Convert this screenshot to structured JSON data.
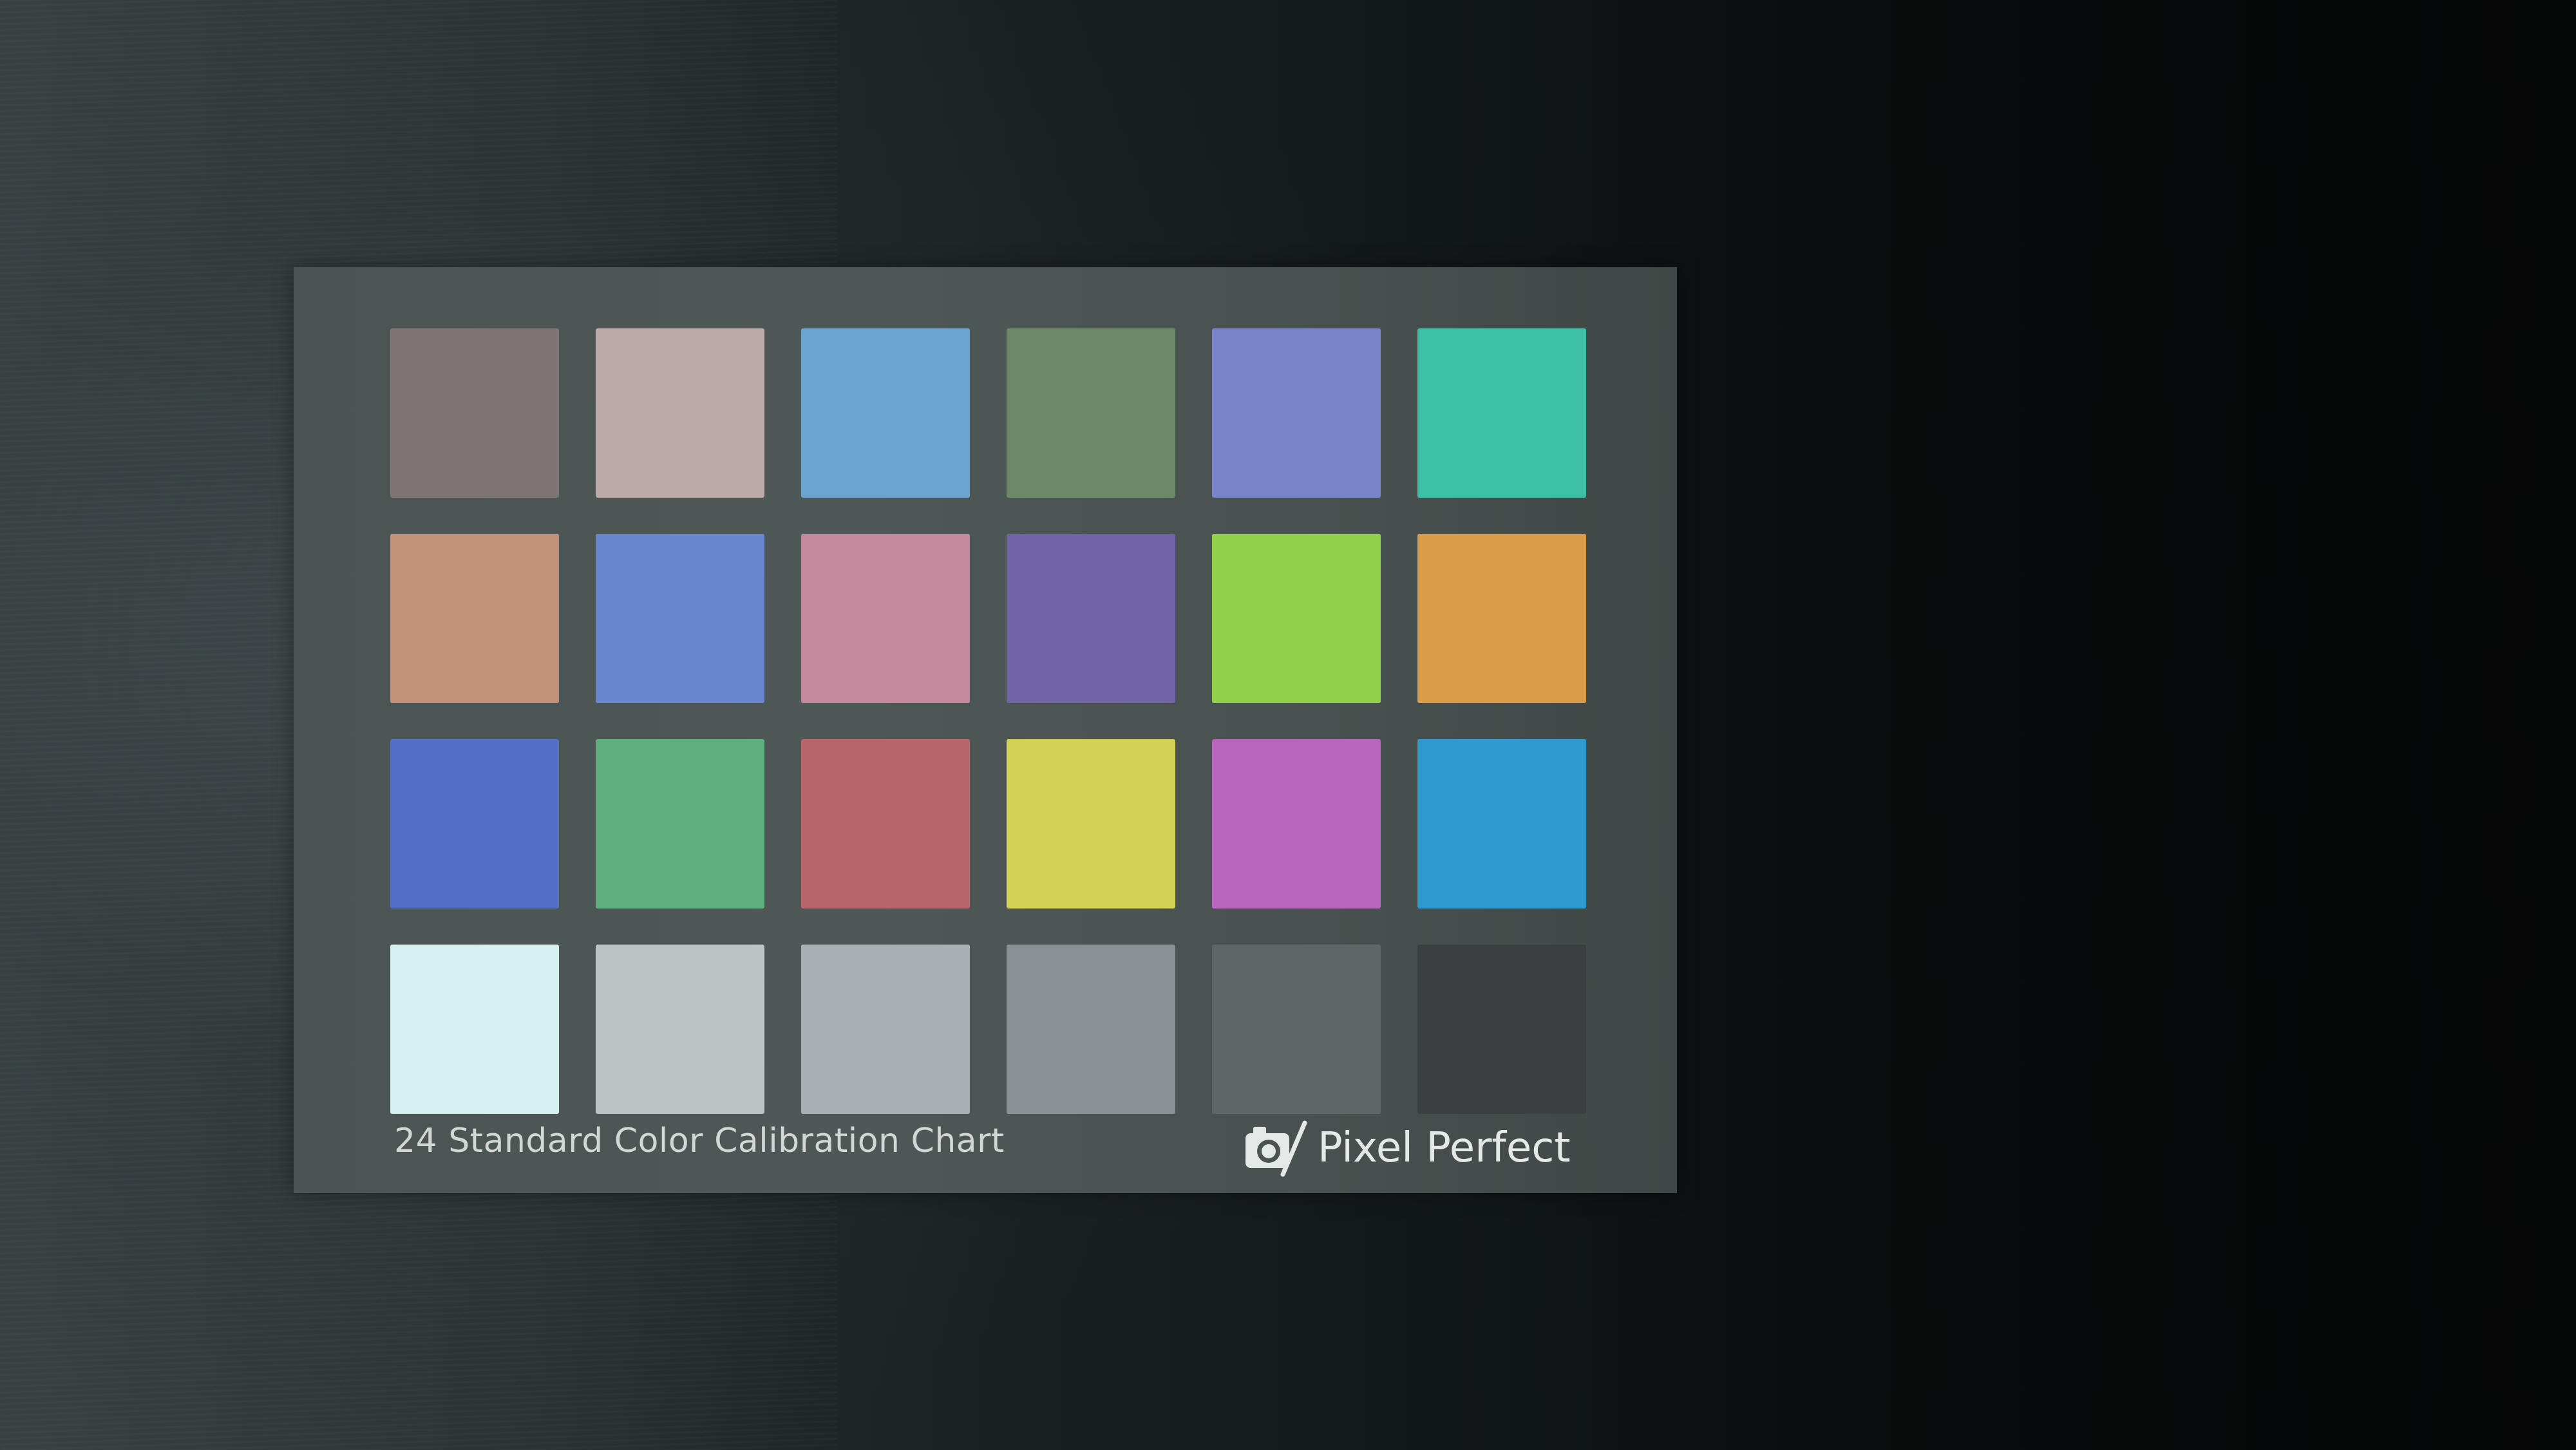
{
  "chart": {
    "caption": "24 Standard Color Calibration Chart",
    "brand": "Pixel Perfect",
    "brand_logo_icon": "camera-slash-icon",
    "rows": [
      [
        "#7d7573",
        "#beaaa6",
        "#6ca3cf",
        "#6c8a6a",
        "#7884c7",
        "#3dbfa8"
      ],
      [
        "#c3917a",
        "#6a86cf",
        "#c5899e",
        "#7064a6",
        "#92d04c",
        "#d99c48"
      ],
      [
        "#5470c6",
        "#5fb07e",
        "#b9656c",
        "#d4d158",
        "#b866bd",
        "#2f9ad0"
      ],
      [
        "#d4f0ef",
        "#bcc3c4",
        "#a7b1b3",
        "#8a9194",
        "#606568",
        "#3c3f42"
      ]
    ]
  }
}
